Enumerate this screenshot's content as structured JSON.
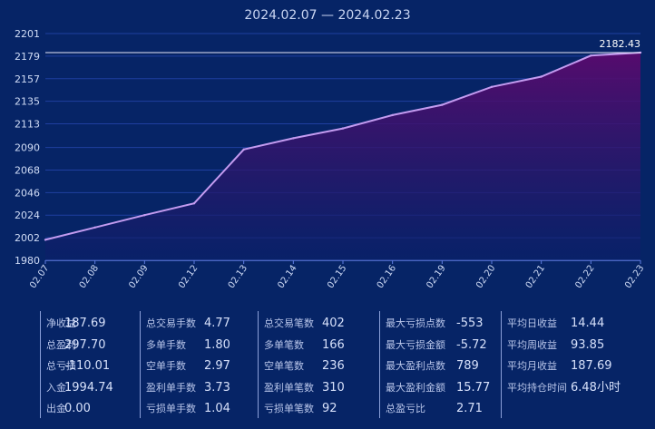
{
  "title": "2024.02.07 — 2024.02.23",
  "colors": {
    "background": "#062466",
    "line": "#c39bf0",
    "area_top": "#5a0a6e",
    "area_bottom": "#0a1f6a",
    "grid": "#1f3fa0",
    "baseline": "#5f7de0",
    "last_value_line": "#e8e8f8"
  },
  "chart_data": {
    "type": "area",
    "title": "2024.02.07 — 2024.02.23",
    "x": [
      "02.07",
      "02.08",
      "02.09",
      "02.12",
      "02.13",
      "02.14",
      "02.15",
      "02.16",
      "02.19",
      "02.20",
      "02.21",
      "02.22",
      "02.23"
    ],
    "series": [
      {
        "values": [
          2000.0,
          2012.0,
          2024.0,
          2035.5,
          2088.0,
          2099.0,
          2108.5,
          2121.5,
          2131.5,
          2149.0,
          2159.0,
          2179.5,
          2182.43
        ]
      }
    ],
    "y_ticks": [
      "1980",
      "2002",
      "2024",
      "2046",
      "2068",
      "2090",
      "2113",
      "2135",
      "2157",
      "2179",
      "2201"
    ],
    "ylim": [
      1980,
      2201
    ],
    "last_value_label": "2182.43",
    "grid": true,
    "xlabel": "",
    "ylabel": ""
  },
  "stats": [
    {
      "key": "col1",
      "items": [
        {
          "label": "净收益",
          "value": "187.69"
        },
        {
          "label": "总盈利",
          "value": "297.70"
        },
        {
          "label": "总亏损",
          "value": "-110.01"
        },
        {
          "label": "入金",
          "value": "1994.74"
        },
        {
          "label": "出金",
          "value": "0.00"
        }
      ]
    },
    {
      "key": "col2",
      "items": [
        {
          "label": "总交易手数",
          "value": "4.77"
        },
        {
          "label": "多单手数",
          "value": "1.80"
        },
        {
          "label": "空单手数",
          "value": "2.97"
        },
        {
          "label": "盈利单手数",
          "value": "3.73"
        },
        {
          "label": "亏损单手数",
          "value": "1.04"
        }
      ]
    },
    {
      "key": "col3",
      "items": [
        {
          "label": "总交易笔数",
          "value": "402"
        },
        {
          "label": "多单笔数",
          "value": "166"
        },
        {
          "label": "空单笔数",
          "value": "236"
        },
        {
          "label": "盈利单笔数",
          "value": "310"
        },
        {
          "label": "亏损单笔数",
          "value": "92"
        }
      ]
    },
    {
      "key": "col4",
      "items": [
        {
          "label": "最大亏损点数",
          "value": "-553"
        },
        {
          "label": "最大亏损金额",
          "value": "-5.72"
        },
        {
          "label": "最大盈利点数",
          "value": "789"
        },
        {
          "label": "最大盈利金额",
          "value": "15.77"
        },
        {
          "label": "总盈亏比",
          "value": "2.71"
        }
      ]
    },
    {
      "key": "col5",
      "items": [
        {
          "label": "平均日收益",
          "value": "14.44"
        },
        {
          "label": "平均周收益",
          "value": "93.85"
        },
        {
          "label": "平均月收益",
          "value": "187.69"
        },
        {
          "label": "平均持仓时间",
          "value": "6.48小时"
        }
      ]
    }
  ]
}
